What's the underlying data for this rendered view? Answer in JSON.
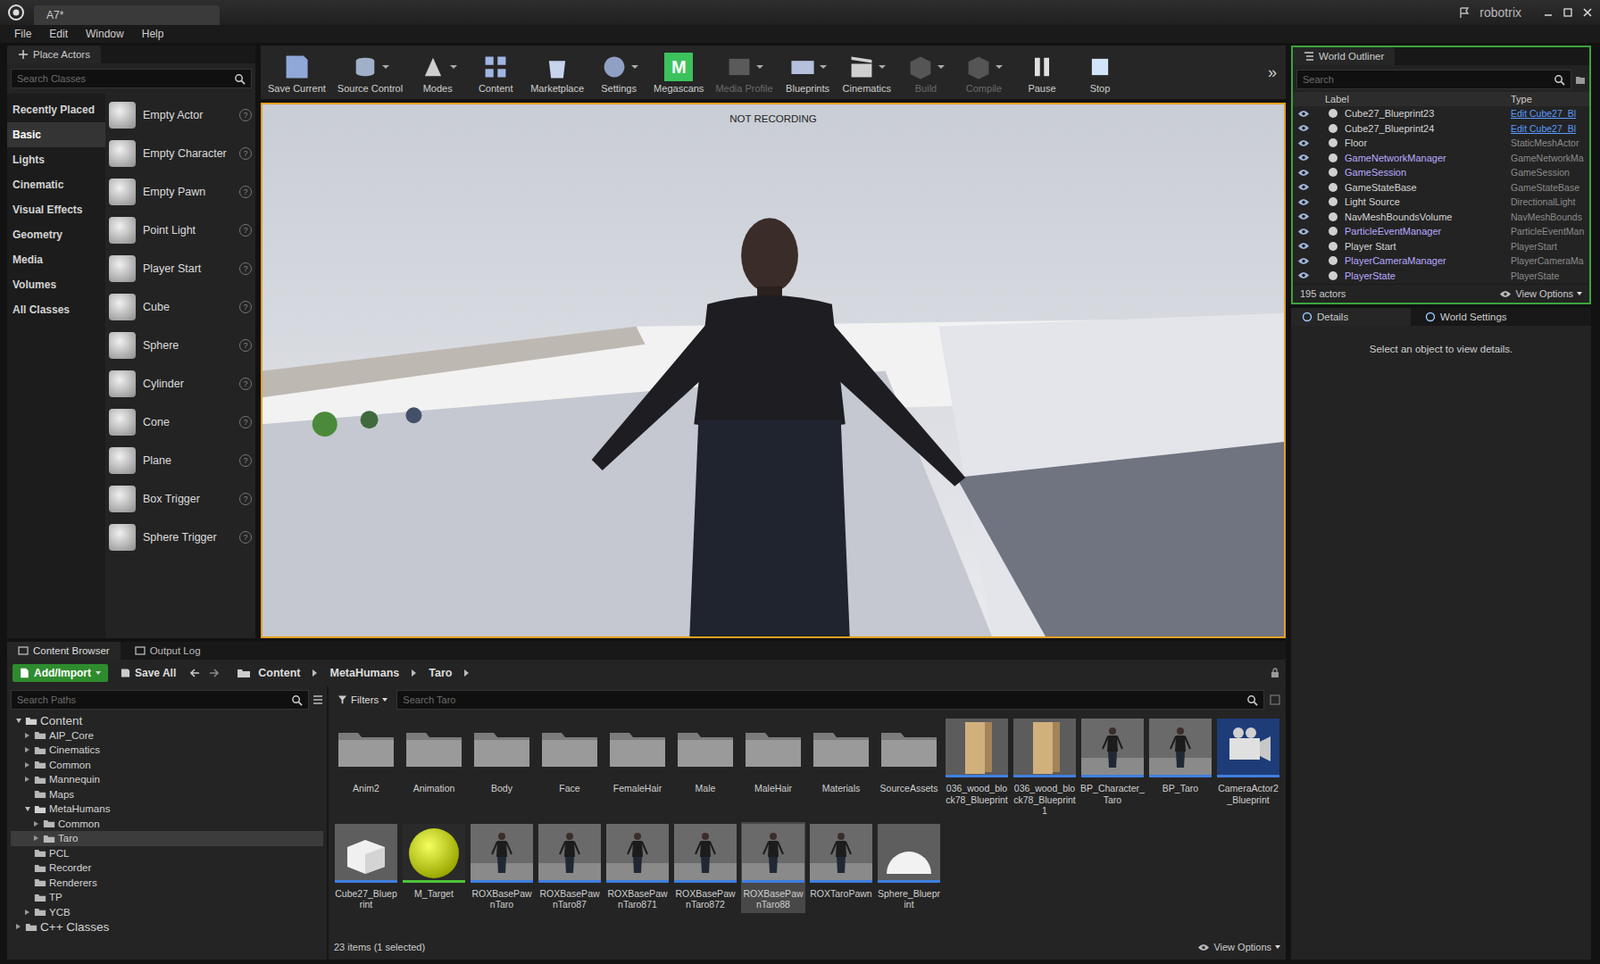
{
  "window": {
    "tab": "A7*",
    "user": "robotrix"
  },
  "menu": [
    "File",
    "Edit",
    "Window",
    "Help"
  ],
  "place_actors": {
    "title": "Place Actors",
    "search_placeholder": "Search Classes",
    "help_glyph": "?",
    "categories": [
      {
        "label": "Recently Placed",
        "selected": false
      },
      {
        "label": "Basic",
        "selected": true
      },
      {
        "label": "Lights",
        "selected": false
      },
      {
        "label": "Cinematic",
        "selected": false
      },
      {
        "label": "Visual Effects",
        "selected": false
      },
      {
        "label": "Geometry",
        "selected": false
      },
      {
        "label": "Media",
        "selected": false
      },
      {
        "label": "Volumes",
        "selected": false
      },
      {
        "label": "All Classes",
        "selected": false
      }
    ],
    "items": [
      "Empty Actor",
      "Empty Character",
      "Empty Pawn",
      "Point Light",
      "Player Start",
      "Cube",
      "Sphere",
      "Cylinder",
      "Cone",
      "Plane",
      "Box Trigger",
      "Sphere Trigger"
    ]
  },
  "toolbar": {
    "buttons": [
      {
        "label": "Save Current",
        "disabled": false,
        "menu": false
      },
      {
        "label": "Source Control",
        "disabled": false,
        "menu": true
      },
      {
        "label": "Modes",
        "disabled": false,
        "menu": true
      },
      {
        "label": "Content",
        "disabled": false,
        "menu": false
      },
      {
        "label": "Marketplace",
        "disabled": false,
        "menu": false
      },
      {
        "label": "Settings",
        "disabled": false,
        "menu": true
      },
      {
        "label": "Megascans",
        "disabled": false,
        "menu": false,
        "glyph": "M"
      },
      {
        "label": "Media Profile",
        "disabled": true,
        "menu": true
      },
      {
        "label": "Blueprints",
        "disabled": false,
        "menu": true
      },
      {
        "label": "Cinematics",
        "disabled": false,
        "menu": true
      },
      {
        "label": "Build",
        "disabled": true,
        "menu": true
      },
      {
        "label": "Compile",
        "disabled": true,
        "menu": true
      },
      {
        "label": "Pause",
        "disabled": false,
        "menu": false
      },
      {
        "label": "Stop",
        "disabled": false,
        "menu": false
      }
    ],
    "overflow": "»"
  },
  "viewport": {
    "overlay": "NOT RECORDING",
    "active": true
  },
  "outliner": {
    "title": "World Outliner",
    "focused": true,
    "search_placeholder": "Search",
    "columns": [
      "Label",
      "Type"
    ],
    "rows": [
      {
        "label": "Cube27_Blueprint23",
        "type": "Edit Cube27_Bl",
        "type_link": true,
        "color": "#d6d6d6"
      },
      {
        "label": "Cube27_Blueprint24",
        "type": "Edit Cube27_Bl",
        "type_link": true,
        "color": "#d6d6d6"
      },
      {
        "label": "Floor",
        "type": "StaticMeshActor",
        "type_link": false,
        "color": "#d6d6d6"
      },
      {
        "label": "GameNetworkManager",
        "type": "GameNetworkMa",
        "type_link": false,
        "color": "#b9aaff"
      },
      {
        "label": "GameSession",
        "type": "GameSession",
        "type_link": false,
        "color": "#b9aaff"
      },
      {
        "label": "GameStateBase",
        "type": "GameStateBase",
        "type_link": false,
        "color": "#d6d6d6"
      },
      {
        "label": "Light Source",
        "type": "DirectionalLight",
        "type_link": false,
        "color": "#d6d6d6"
      },
      {
        "label": "NavMeshBoundsVolume",
        "type": "NavMeshBounds",
        "type_link": false,
        "color": "#d6d6d6"
      },
      {
        "label": "ParticleEventManager",
        "type": "ParticleEventMan",
        "type_link": false,
        "color": "#b9aaff"
      },
      {
        "label": "Player Start",
        "type": "PlayerStart",
        "type_link": false,
        "color": "#d6d6d6"
      },
      {
        "label": "PlayerCameraManager",
        "type": "PlayerCameraMa",
        "type_link": false,
        "color": "#b9aaff"
      },
      {
        "label": "PlayerState",
        "type": "PlayerState",
        "type_link": false,
        "color": "#b9aaff"
      }
    ],
    "count": "195 actors",
    "view_options": "View Options"
  },
  "details": {
    "tabs": [
      {
        "label": "Details",
        "selected": true
      },
      {
        "label": "World Settings",
        "selected": false
      }
    ],
    "empty": "Select an object to view details."
  },
  "bottom_tabs": [
    {
      "label": "Content Browser",
      "selected": true
    },
    {
      "label": "Output Log",
      "selected": false
    }
  ],
  "content_browser": {
    "add_import": "Add/Import",
    "save_all": "Save All",
    "path": [
      "Content",
      "MetaHumans",
      "Taro"
    ],
    "path_search": "Search Paths",
    "tree": [
      {
        "label": "Content",
        "depth": 0,
        "children": true,
        "expanded": true,
        "selected": false
      },
      {
        "label": "AIP_Core",
        "depth": 1,
        "children": true,
        "expanded": false,
        "selected": false
      },
      {
        "label": "Cinematics",
        "depth": 1,
        "children": true,
        "expanded": false,
        "selected": false
      },
      {
        "label": "Common",
        "depth": 1,
        "children": true,
        "expanded": false,
        "selected": false
      },
      {
        "label": "Mannequin",
        "depth": 1,
        "children": true,
        "expanded": false,
        "selected": false
      },
      {
        "label": "Maps",
        "depth": 1,
        "children": false,
        "expanded": false,
        "selected": false
      },
      {
        "label": "MetaHumans",
        "depth": 1,
        "children": true,
        "expanded": true,
        "selected": false
      },
      {
        "label": "Common",
        "depth": 2,
        "children": true,
        "expanded": false,
        "selected": false
      },
      {
        "label": "Taro",
        "depth": 2,
        "children": true,
        "expanded": false,
        "selected": true
      },
      {
        "label": "PCL",
        "depth": 1,
        "children": false,
        "expanded": false,
        "selected": false
      },
      {
        "label": "Recorder",
        "depth": 1,
        "children": false,
        "expanded": false,
        "selected": false
      },
      {
        "label": "Renderers",
        "depth": 1,
        "children": false,
        "expanded": false,
        "selected": false
      },
      {
        "label": "TP",
        "depth": 1,
        "children": false,
        "expanded": false,
        "selected": false
      },
      {
        "label": "YCB",
        "depth": 1,
        "children": true,
        "expanded": false,
        "selected": false
      },
      {
        "label": "C++ Classes",
        "depth": 0,
        "children": true,
        "expanded": false,
        "selected": false
      }
    ],
    "filters": "Filters",
    "search_placeholder": "Search Taro",
    "assets": [
      {
        "label": "Anim2",
        "kind": "folder",
        "selected": false
      },
      {
        "label": "Animation",
        "kind": "folder",
        "selected": false
      },
      {
        "label": "Body",
        "kind": "folder",
        "selected": false
      },
      {
        "label": "Face",
        "kind": "folder",
        "selected": false
      },
      {
        "label": "FemaleHair",
        "kind": "folder",
        "selected": false
      },
      {
        "label": "Male",
        "kind": "folder",
        "selected": false
      },
      {
        "label": "MaleHair",
        "kind": "folder",
        "selected": false
      },
      {
        "label": "Materials",
        "kind": "folder",
        "selected": false
      },
      {
        "label": "SourceAssets",
        "kind": "folder",
        "selected": false
      },
      {
        "label": "036_wood_block78_Blueprint",
        "kind": "wood",
        "selected": false,
        "color": "#3f7fe0"
      },
      {
        "label": "036_wood_block78_Blueprint1",
        "kind": "wood",
        "selected": false,
        "color": "#3f7fe0"
      },
      {
        "label": "BP_Character_Taro",
        "kind": "character",
        "selected": false,
        "color": "#3f7fe0"
      },
      {
        "label": "BP_Taro",
        "kind": "character",
        "selected": false,
        "color": "#3f7fe0"
      },
      {
        "label": "CameraActor2_Blueprint",
        "kind": "camera",
        "selected": false,
        "color": "#3f7fe0"
      },
      {
        "label": "Cube27_Blueprint",
        "kind": "cube",
        "selected": false,
        "color": "#3f7fe0"
      },
      {
        "label": "M_Target",
        "kind": "material",
        "selected": false,
        "color": "#4fc23a"
      },
      {
        "label": "ROXBasePawnTaro",
        "kind": "character",
        "selected": false,
        "color": "#3f7fe0"
      },
      {
        "label": "ROXBasePawnTaro87",
        "kind": "character",
        "selected": false,
        "color": "#3f7fe0"
      },
      {
        "label": "ROXBasePawnTaro871",
        "kind": "character",
        "selected": false,
        "color": "#3f7fe0"
      },
      {
        "label": "ROXBasePawnTaro872",
        "kind": "character",
        "selected": false,
        "color": "#3f7fe0"
      },
      {
        "label": "ROXBasePawnTaro88",
        "kind": "character",
        "selected": true,
        "color": "#3f7fe0"
      },
      {
        "label": "ROXTaroPawn",
        "kind": "character",
        "selected": false,
        "color": "#3f7fe0"
      },
      {
        "label": "Sphere_Blueprint",
        "kind": "sphere",
        "selected": false,
        "color": "#3f7fe0"
      }
    ],
    "status": "23 items (1 selected)",
    "view_options": "View Options"
  }
}
